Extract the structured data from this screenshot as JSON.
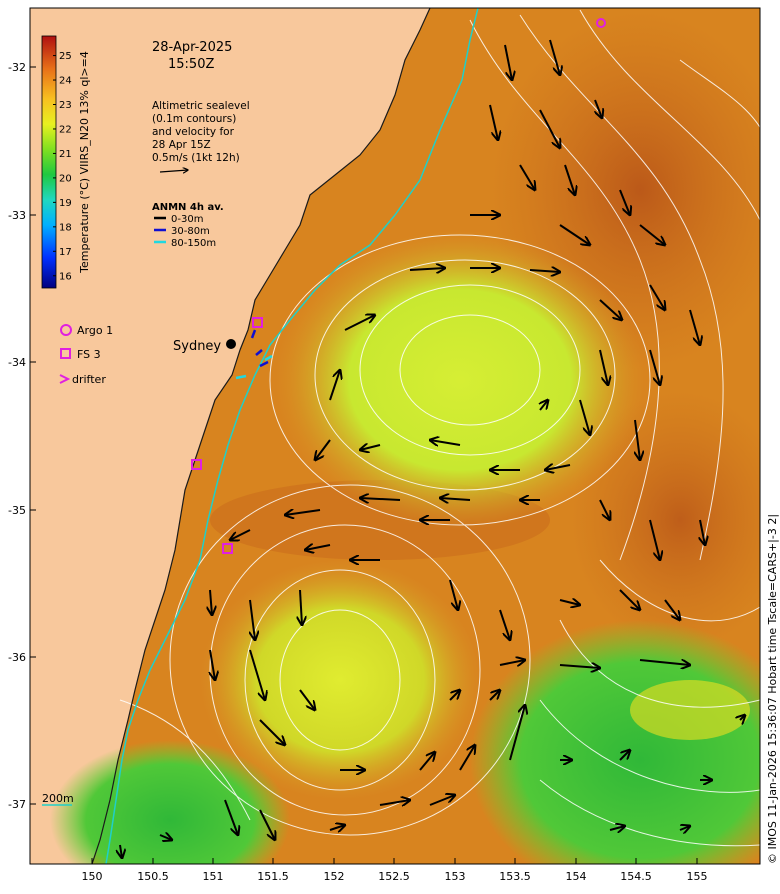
{
  "map": {
    "date_line": "28-Apr-2025",
    "time_line": "15:50Z",
    "info_lines": [
      "Altimetric sealevel",
      "(0.1m contours)",
      "and velocity for",
      "28 Apr 15Z",
      "0.5m/s (1kt 12h)"
    ],
    "anmn_title": "ANMN 4h av.",
    "anmn_items": [
      {
        "label": "0-30m",
        "color": "#000000"
      },
      {
        "label": "30-80m",
        "color": "#1010d0"
      },
      {
        "label": "80-150m",
        "color": "#20d8e0"
      }
    ],
    "legend_items": [
      {
        "label": "Argo 1",
        "symbol": "circle-icon",
        "color": "#e020e0"
      },
      {
        "label": "FS 3",
        "symbol": "square-icon",
        "color": "#e020e0"
      },
      {
        "label": "drifter",
        "symbol": "chevron-icon",
        "color": "#e020e0"
      }
    ],
    "city_label": "Sydney",
    "isobath_label": "200m",
    "colorbar": {
      "label": "Temperature (°C) VIIRS_N20 13% ql>=4",
      "min": 15.5,
      "max": 25.8,
      "ticks": [
        16,
        17,
        18,
        19,
        20,
        21,
        22,
        23,
        24,
        25
      ]
    },
    "x_ticks": [
      "150",
      "150.5",
      "151",
      "151.5",
      "152",
      "152.5",
      "153",
      "153.5",
      "154",
      "154.5",
      "155"
    ],
    "y_ticks": [
      "-32",
      "-33",
      "-34",
      "-35",
      "-36",
      "-37"
    ],
    "credit": "© IMOS 11-Jan-2026 15:36:07 Hobart time Tscale=CARS+|-3 2|",
    "colors": {
      "land": "#f8c89c",
      "warm_water": "#d8761c",
      "eddy_core": "#d2ec30",
      "cool_water": "#40c040",
      "isobath": "#20d0c8"
    }
  }
}
